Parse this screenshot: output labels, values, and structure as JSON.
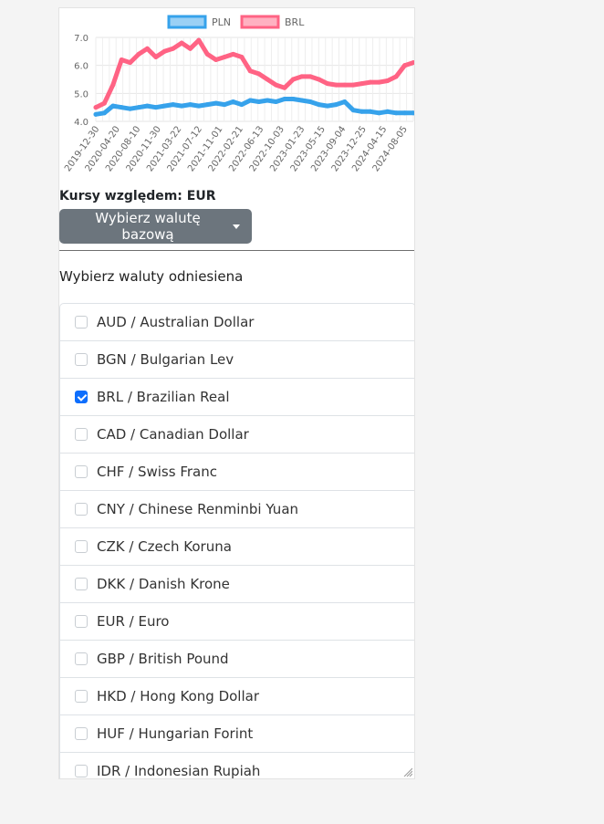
{
  "chart_data": {
    "type": "line",
    "legend": [
      "PLN",
      "BRL"
    ],
    "legend_position": "top",
    "yticks": [
      "4.0",
      "5.0",
      "6.0",
      "7.0"
    ],
    "ylim": [
      4.0,
      7.0
    ],
    "grid": true,
    "x_tick_labels": [
      "2019-12-30",
      "2020-04-20",
      "2020-08-10",
      "2020-11-30",
      "2021-03-22",
      "2021-07-12",
      "2021-11-01",
      "2022-02-21",
      "2022-06-13",
      "2022-10-03",
      "2023-01-23",
      "2023-05-15",
      "2023-09-04",
      "2023-12-25",
      "2024-04-15",
      "2024-08-05"
    ],
    "colors": {
      "PLN": "#36a2eb",
      "BRL": "#ff6384"
    },
    "series": [
      {
        "name": "PLN",
        "values": [
          4.25,
          4.3,
          4.55,
          4.5,
          4.45,
          4.5,
          4.55,
          4.5,
          4.55,
          4.6,
          4.55,
          4.6,
          4.55,
          4.6,
          4.65,
          4.6,
          4.7,
          4.6,
          4.75,
          4.7,
          4.75,
          4.7,
          4.8,
          4.8,
          4.75,
          4.7,
          4.6,
          4.55,
          4.6,
          4.7,
          4.4,
          4.35,
          4.35,
          4.3,
          4.35,
          4.3,
          4.3,
          4.3
        ]
      },
      {
        "name": "BRL",
        "values": [
          4.5,
          4.65,
          5.3,
          6.2,
          6.1,
          6.4,
          6.6,
          6.3,
          6.5,
          6.6,
          6.8,
          6.6,
          6.9,
          6.4,
          6.2,
          6.3,
          6.4,
          6.3,
          5.8,
          5.7,
          5.5,
          5.3,
          5.2,
          5.5,
          5.6,
          5.6,
          5.5,
          5.35,
          5.3,
          5.3,
          5.3,
          5.35,
          5.4,
          5.4,
          5.45,
          5.6,
          6.0,
          6.1
        ]
      }
    ]
  },
  "base": {
    "label": "Kursy względem: EUR",
    "button": "Wybierz walutę bazową"
  },
  "refs": {
    "label": "Wybierz waluty odniesiena",
    "items": [
      {
        "label": "AUD / Australian Dollar",
        "checked": false
      },
      {
        "label": "BGN / Bulgarian Lev",
        "checked": false
      },
      {
        "label": "BRL / Brazilian Real",
        "checked": true
      },
      {
        "label": "CAD / Canadian Dollar",
        "checked": false
      },
      {
        "label": "CHF / Swiss Franc",
        "checked": false
      },
      {
        "label": "CNY / Chinese Renminbi Yuan",
        "checked": false
      },
      {
        "label": "CZK / Czech Koruna",
        "checked": false
      },
      {
        "label": "DKK / Danish Krone",
        "checked": false
      },
      {
        "label": "EUR / Euro",
        "checked": false
      },
      {
        "label": "GBP / British Pound",
        "checked": false
      },
      {
        "label": "HKD / Hong Kong Dollar",
        "checked": false
      },
      {
        "label": "HUF / Hungarian Forint",
        "checked": false
      },
      {
        "label": "IDR / Indonesian Rupiah",
        "checked": false
      }
    ]
  }
}
